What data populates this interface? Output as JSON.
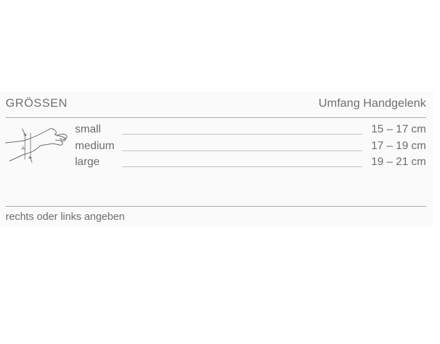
{
  "header": {
    "title": "GRÖSSEN",
    "column_label": "Umfang Handgelenk"
  },
  "sizes": [
    {
      "name": "small",
      "range": "15 – 17 cm"
    },
    {
      "name": "medium",
      "range": "17 – 19 cm"
    },
    {
      "name": "large",
      "range": "19 – 21 cm"
    }
  ],
  "illustration": {
    "icon": "wrist-measurement-icon",
    "marker_label": "A"
  },
  "footnote": "rechts oder links angeben",
  "colors": {
    "text": "#6f6f6f",
    "rule": "#a9a9a9",
    "leader": "#bdbdbd",
    "panel": "#fafafa"
  }
}
